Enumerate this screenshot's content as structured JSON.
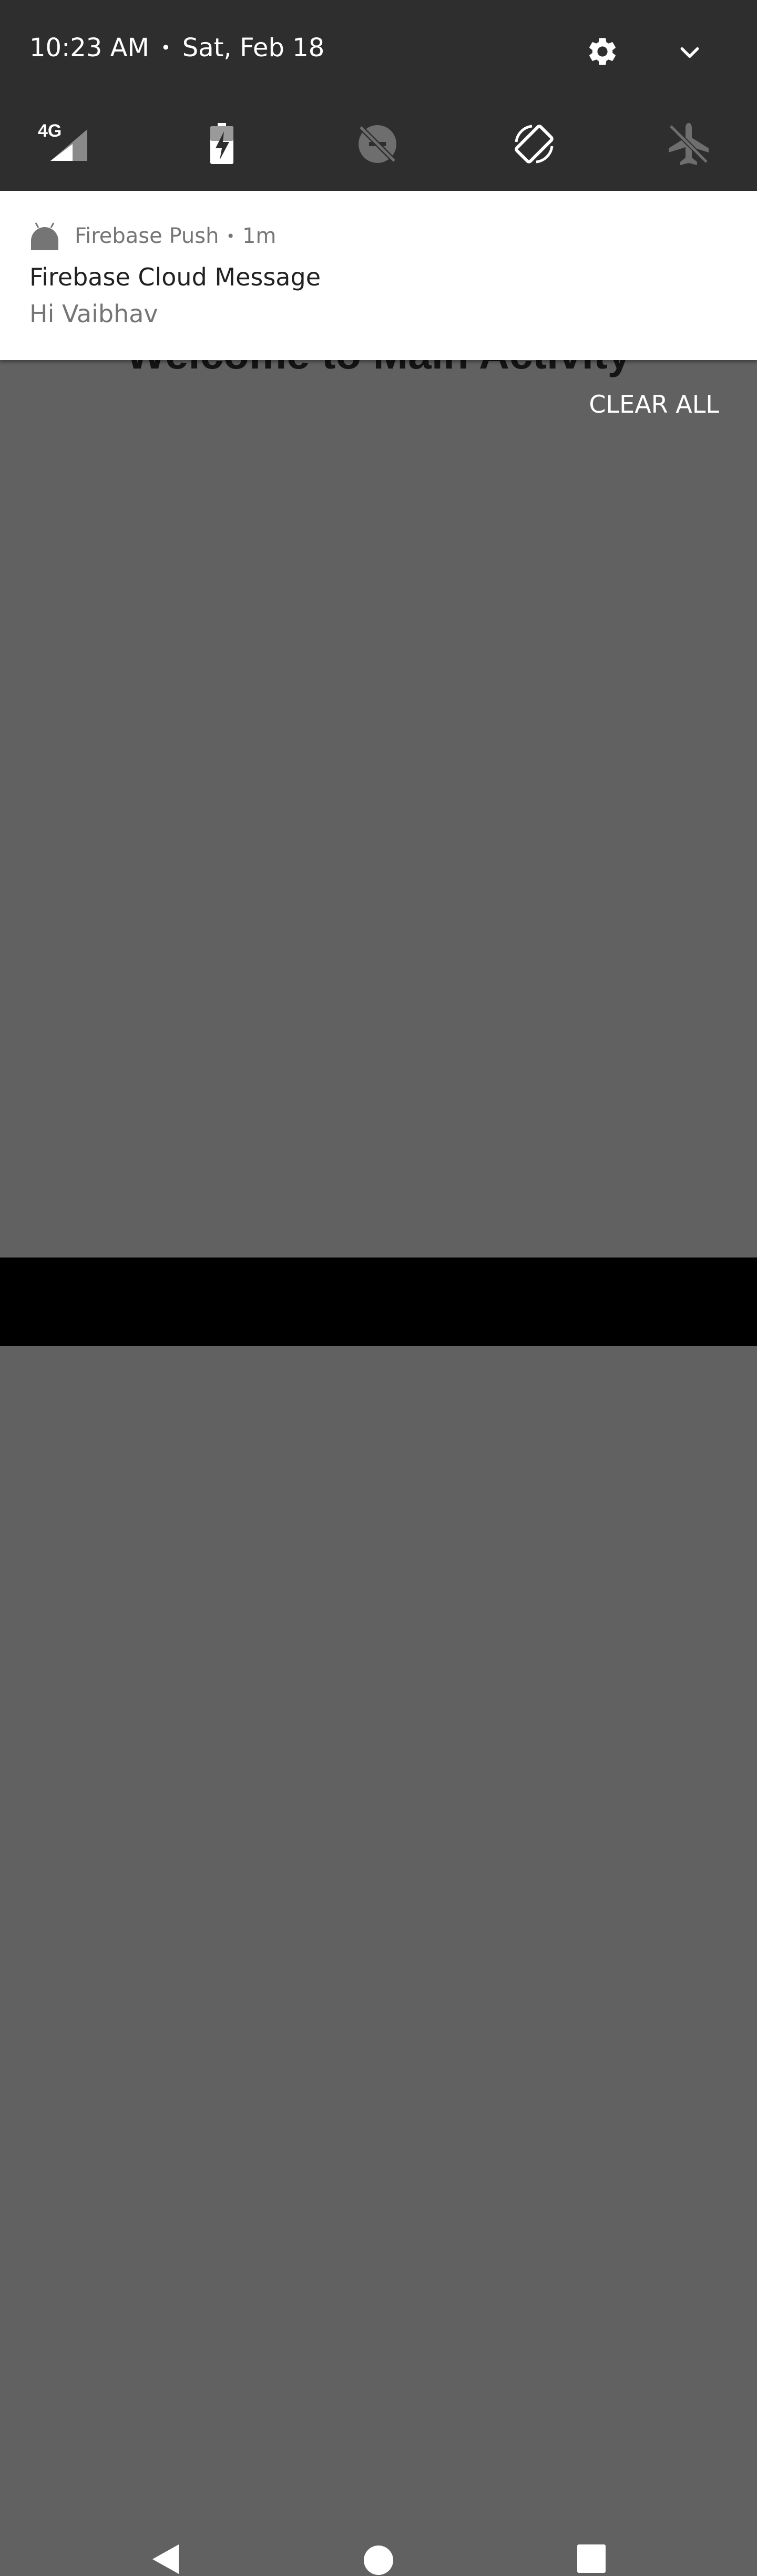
{
  "status": {
    "time": "10:23 AM",
    "date": "Sat, Feb 18",
    "settings_icon": "gear-icon",
    "expand_icon": "chevron-down-icon"
  },
  "quick_settings": [
    {
      "name": "mobile-data",
      "icon": "signal-4g-icon",
      "badge": "4G",
      "active": true
    },
    {
      "name": "battery-saver",
      "icon": "battery-charging-icon",
      "active": true
    },
    {
      "name": "do-not-disturb",
      "icon": "do-not-disturb-off-icon",
      "active": false
    },
    {
      "name": "auto-rotate",
      "icon": "screen-rotation-icon",
      "active": true
    },
    {
      "name": "airplane-mode",
      "icon": "airplane-off-icon",
      "active": false
    }
  ],
  "notification": {
    "app_icon": "android-icon",
    "app_name": "Firebase Push",
    "time_ago": "1m",
    "title": "Firebase Cloud Message",
    "text": "Hi Vaibhav"
  },
  "background_activity": {
    "title": "Welcome to Main Activity"
  },
  "clear_all_label": "CLEAR ALL",
  "navbar": {
    "back_icon": "back-triangle-icon",
    "home_icon": "home-circle-icon",
    "recents_icon": "recents-square-icon"
  },
  "colors": {
    "header_bg": "#2e2e2e",
    "scrim": "#616161",
    "notification_bg": "#ffffff",
    "navbar_bg": "#000000"
  }
}
